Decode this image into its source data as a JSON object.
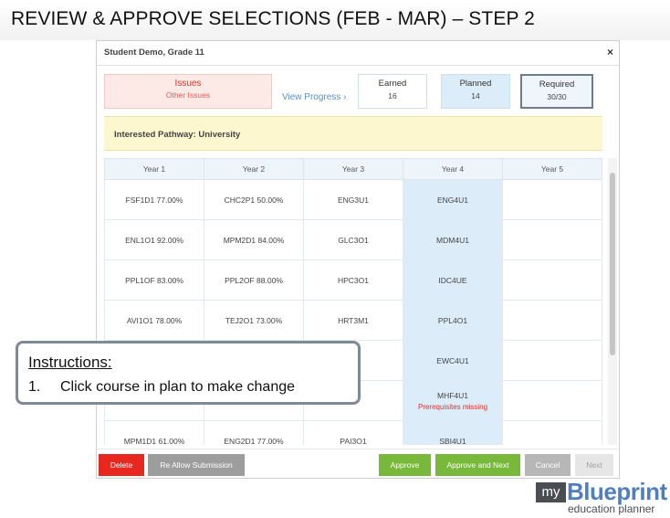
{
  "slide": {
    "title": "REVIEW & APPROVE SELECTIONS (FEB - MAR) – STEP 2"
  },
  "modal": {
    "title": "Student Demo, Grade 11",
    "close_label": "×"
  },
  "summary": {
    "issues_title": "Issues",
    "issues_sub": "Other Issues",
    "view_progress": "View Progress ›",
    "earned_label": "Earned",
    "earned_value": "16",
    "planned_label": "Planned",
    "planned_value": "14",
    "required_label": "Required",
    "required_value": "30/30"
  },
  "pathway": {
    "label": "Interested Pathway: University"
  },
  "plan": {
    "headers": [
      "Year 1",
      "Year 2",
      "Year 3",
      "Year 4",
      "Year 5"
    ],
    "rows": [
      [
        "FSF1D1 77.00%",
        "CHC2P1 50.00%",
        "ENG3U1",
        "ENG4U1",
        ""
      ],
      [
        "ENL1O1 92.00%",
        "MPM2D1 84.00%",
        "GLC3O1",
        "MDM4U1",
        ""
      ],
      [
        "PPL1OF 83.00%",
        "PPL2OF 88.00%",
        "HPC3O1",
        "IDC4UE",
        ""
      ],
      [
        "AVI1O1 78.00%",
        "TEJ2O1 73.00%",
        "HRT3M1",
        "PPL4O1",
        ""
      ],
      [
        "",
        "",
        "",
        "EWC4U1",
        ""
      ],
      [
        "",
        "",
        "",
        "MHF4U1",
        ""
      ],
      [
        "MPM1D1 61.00%",
        "ENG2D1 77.00%",
        "PAI3O1",
        "SBI4U1",
        ""
      ]
    ],
    "warning": "Prerequisites missing"
  },
  "footer": {
    "delete": "Delete",
    "reallow": "Re Allow Submission",
    "approve": "Approve",
    "approve_next": "Approve and Next",
    "cancel": "Cancel",
    "next": "Next"
  },
  "instructions": {
    "heading": "Instructions:",
    "step_number": "1.",
    "step_text": "Click course in plan to make change"
  },
  "logo": {
    "my": "my",
    "name": "Blueprint",
    "sub": "education planner"
  },
  "colors": {
    "danger": "#e8281f",
    "success": "#78b83b",
    "brand": "#4f7fc1",
    "pathway_bg": "#fdf7cf",
    "year4_bg": "#dcecf9"
  }
}
